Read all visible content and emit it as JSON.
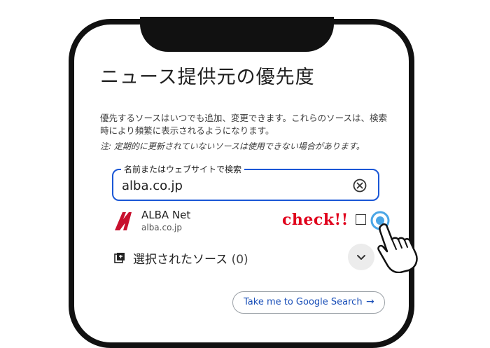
{
  "page": {
    "title": "ニュース提供元の優先度",
    "description": "優先するソースはいつでも追加、変更できます。これらのソースは、検索時により頻繁に表示されるようになります。",
    "note": "注: 定期的に更新されていないソースは使用できない場合があります。"
  },
  "search": {
    "label": "名前またはウェブサイトで検索",
    "value": "alba.co.jp"
  },
  "result": {
    "logo_letter": "A",
    "name": "ALBA Net",
    "url": "alba.co.jp",
    "annotation": "check!!"
  },
  "selected": {
    "label": "選択されたソース",
    "count": "(0)"
  },
  "google_button": {
    "label": "Take me to Google Search",
    "arrow": "→"
  },
  "icons": [
    "clear-icon",
    "alba-logo",
    "checkbox",
    "tap-indicator-icon",
    "pointing-hand-icon",
    "sources-icon",
    "chevron-down-icon",
    "arrow-right-icon"
  ],
  "colors": {
    "accent_blue": "#1a57d6",
    "annotation_red": "#e0001b",
    "tap_blue": "#4aa6e6",
    "logo_red": "#c8102e"
  }
}
